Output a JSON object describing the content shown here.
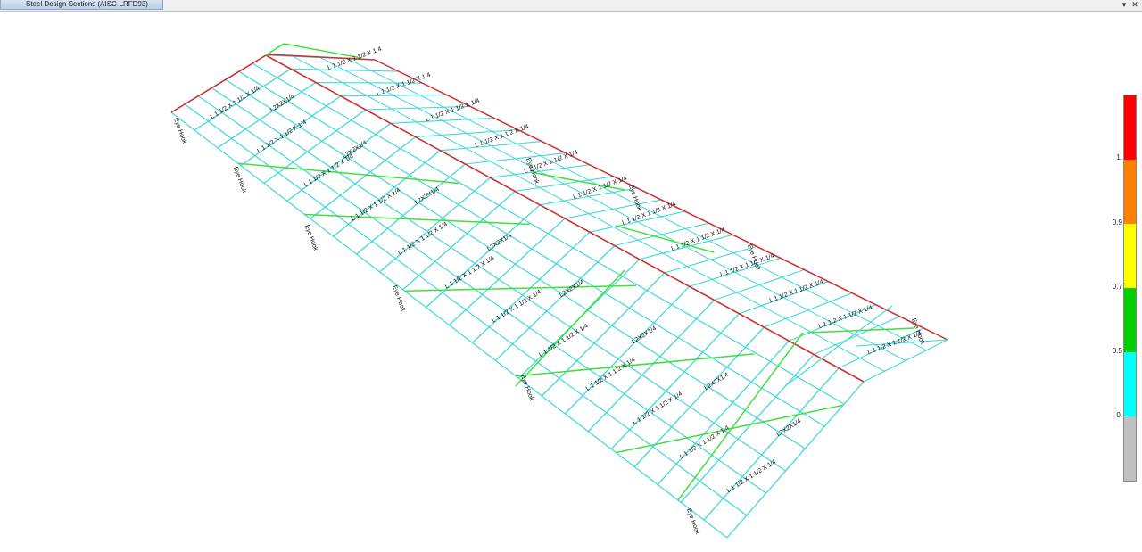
{
  "window": {
    "tab_title": "Steel Design Sections  (AISC-LRFD93)",
    "dropdown_glyph": "▾",
    "close_glyph": "✕"
  },
  "legend": {
    "labels": [
      "1.",
      "0.9",
      "0.7",
      "0.5",
      "0."
    ],
    "segments": [
      {
        "color": "#ff0000",
        "fraction": 0.166
      },
      {
        "color": "#ff8000",
        "fraction": 0.166
      },
      {
        "color": "#ffff00",
        "fraction": 0.166
      },
      {
        "color": "#00d000",
        "fraction": 0.166
      },
      {
        "color": "#00ffff",
        "fraction": 0.166
      },
      {
        "color": "#c0c0c0",
        "fraction": 0.17
      }
    ]
  },
  "colors": {
    "member_default": "#40d8d8",
    "member_ridge": "#d03030",
    "member_green": "#40e040",
    "label": "#111111"
  },
  "section_labels": {
    "angle_large": "L 1 1/2 X 1 1/2 X 1/4",
    "angle_small": "L2X2X1/4",
    "eye_hook": "Eye Hook"
  }
}
